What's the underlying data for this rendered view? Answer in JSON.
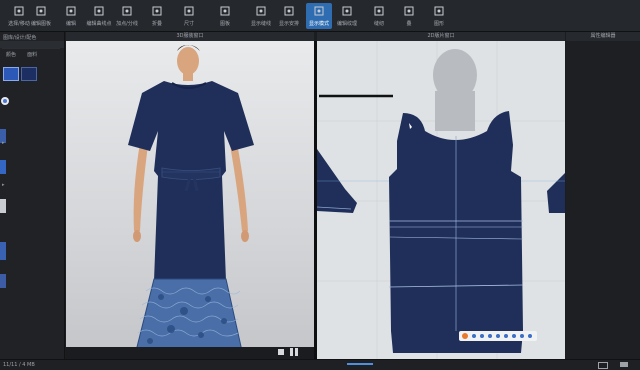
{
  "toolbar": {
    "tools": [
      {
        "label": "选择/移动",
        "icon": "select-icon"
      },
      {
        "label": "编辑图板",
        "icon": "edit-pattern-icon"
      },
      {
        "label": "编辑",
        "icon": "edit-icon"
      },
      {
        "label": "编辑曲线点",
        "icon": "curve-point-icon"
      },
      {
        "label": "加点/分线",
        "icon": "add-point-icon"
      },
      {
        "label": "折叠",
        "icon": "fold-icon"
      },
      {
        "label": "尺寸",
        "icon": "measure-icon"
      },
      {
        "label": "图板",
        "icon": "pattern-icon"
      },
      {
        "label": "显示缝线",
        "icon": "seam-icon"
      },
      {
        "label": "显示安排",
        "icon": "arrange-icon"
      },
      {
        "label": "显示模式",
        "icon": "display-mode-icon"
      },
      {
        "label": "编辑纹理",
        "icon": "texture-icon"
      },
      {
        "label": "缝纫",
        "icon": "sewing-icon"
      },
      {
        "label": "叠",
        "icon": "fold-arrange-icon"
      },
      {
        "label": "图形",
        "icon": "graphic-icon"
      }
    ],
    "active_index": 10
  },
  "sidebar": {
    "header": "图库/设计/配色",
    "tabs": [
      "颜色",
      "面料"
    ],
    "status": "11/11 / 4 MB"
  },
  "panels": {
    "view3d_title": "3D服装窗口",
    "view2d_title": "2D版片窗口",
    "right_title": "属性编辑器"
  },
  "colors": {
    "fabric_navy": "#1f2f5a",
    "lace_blue": "#4a6fa8",
    "active_tool": "#2f6db3"
  }
}
